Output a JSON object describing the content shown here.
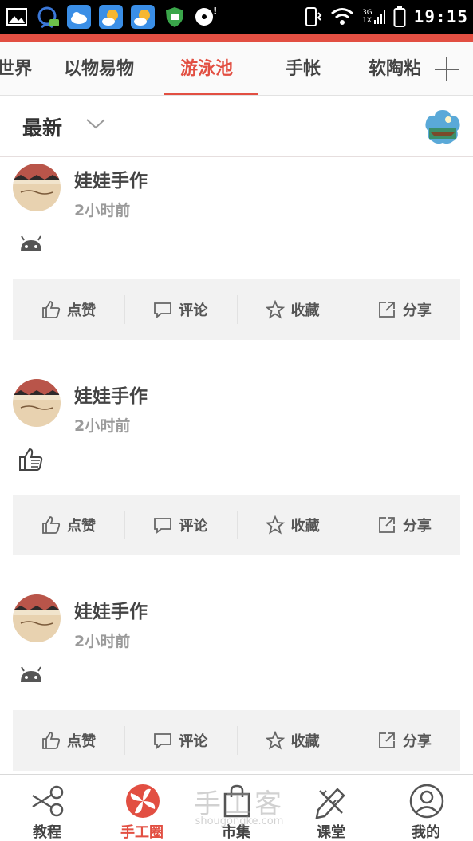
{
  "status_bar": {
    "time": "19:15",
    "network_top": "3G",
    "network_bottom": "1X"
  },
  "tabs": {
    "items": [
      {
        "label": "世界"
      },
      {
        "label": "以物易物"
      },
      {
        "label": "游泳池",
        "active": true
      },
      {
        "label": "手帐"
      },
      {
        "label": "软陶粘"
      }
    ],
    "add_icon": "plus-icon"
  },
  "filter": {
    "label": "最新",
    "chevron_icon": "chevron-down-icon"
  },
  "posts": [
    {
      "author": "娃娃手作",
      "time": "2小时前",
      "content_icon": "android-emoji-icon"
    },
    {
      "author": "娃娃手作",
      "time": "2小时前",
      "content_icon": "thumbs-up-emoji-icon"
    },
    {
      "author": "娃娃手作",
      "time": "2小时前",
      "content_icon": "android-emoji-icon"
    }
  ],
  "post_actions": {
    "like": "点赞",
    "comment": "评论",
    "favorite": "收藏",
    "share": "分享"
  },
  "bottom_nav": [
    {
      "label": "教程",
      "icon": "scissors-icon"
    },
    {
      "label": "手工圈",
      "icon": "pinwheel-icon",
      "active": true
    },
    {
      "label": "市集",
      "icon": "shopping-bag-icon"
    },
    {
      "label": "课堂",
      "icon": "pencil-ruler-icon"
    },
    {
      "label": "我的",
      "icon": "user-icon"
    }
  ],
  "watermark": {
    "text": "手工客",
    "url": "shougongke.com"
  },
  "colors": {
    "accent": "#e24f42",
    "status_bar": "#000000",
    "action_bar_bg": "#f2f2f2"
  }
}
